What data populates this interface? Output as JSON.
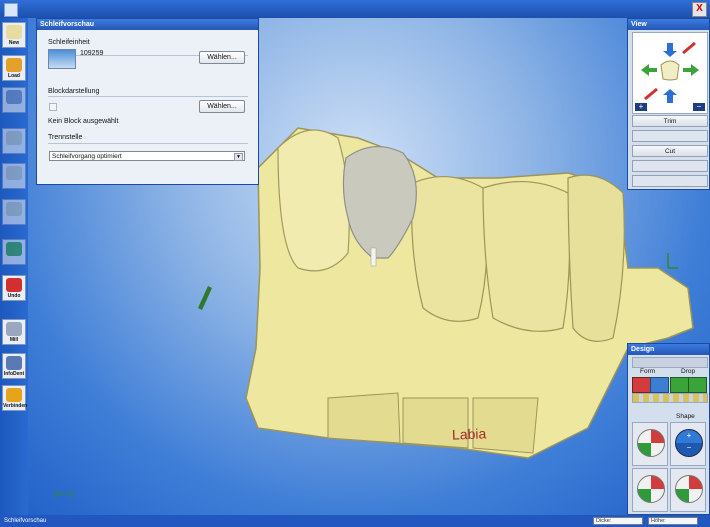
{
  "app": {
    "close_glyph": "X"
  },
  "toolbar": {
    "buttons": [
      {
        "label": "New",
        "icon": "tooth-icon",
        "disabled": false
      },
      {
        "label": "Load",
        "icon": "folder-icon",
        "disabled": false
      },
      {
        "label": "",
        "icon": "save-icon",
        "disabled": true
      },
      {
        "label": "",
        "icon": "tooth-icon",
        "disabled": true
      },
      {
        "label": "",
        "icon": "tooth-icon",
        "disabled": true
      },
      {
        "label": "",
        "icon": "tooth-icon",
        "disabled": true
      },
      {
        "label": "",
        "icon": "forward-arrow-icon",
        "disabled": true
      },
      {
        "label": "Undo",
        "icon": "undo-icon",
        "disabled": false
      },
      {
        "label": "Mill",
        "icon": "mill-icon",
        "disabled": false
      },
      {
        "label": "InfoDent",
        "icon": "info-icon",
        "disabled": false
      },
      {
        "label": "Verbinden",
        "icon": "globe-icon",
        "disabled": false
      }
    ]
  },
  "schleif_panel": {
    "title": "Schleifvorschau",
    "unit_label": "Schleifeinheit",
    "unit_id": "109259",
    "unit_button": "Wählen...",
    "block_label": "Blockdarstellung",
    "block_button": "Wählen...",
    "block_status": "Kein Block ausgewählt",
    "separation_label": "Trennstelle",
    "separation_value": "Schleifvorgang optimiert"
  },
  "view_panel": {
    "title": "View",
    "zoom_in": "+",
    "zoom_out": "−",
    "buttons": [
      {
        "label": "Trim",
        "disabled": false
      },
      {
        "label": "",
        "disabled": true
      },
      {
        "label": "Cut",
        "disabled": false
      },
      {
        "label": "",
        "disabled": true
      },
      {
        "label": "",
        "disabled": true
      }
    ]
  },
  "design_panel": {
    "title": "Design",
    "form_label": "Form",
    "drop_label": "Drop",
    "shape_label": "Shape",
    "shape_plus": "+",
    "shape_minus": "−"
  },
  "viewport": {
    "label_text": "Labia"
  },
  "statusbar": {
    "left_text": "Schleifvorschau",
    "dicke_label": "Dicke:",
    "hoehe_label": "Höhe:"
  },
  "colors": {
    "tooth": "#ede7a0",
    "crown": "#c9c9bd",
    "titlebar": "#2457b8",
    "viewport_center": "#cfe0f6",
    "viewport_edge": "#1f5ec6"
  }
}
